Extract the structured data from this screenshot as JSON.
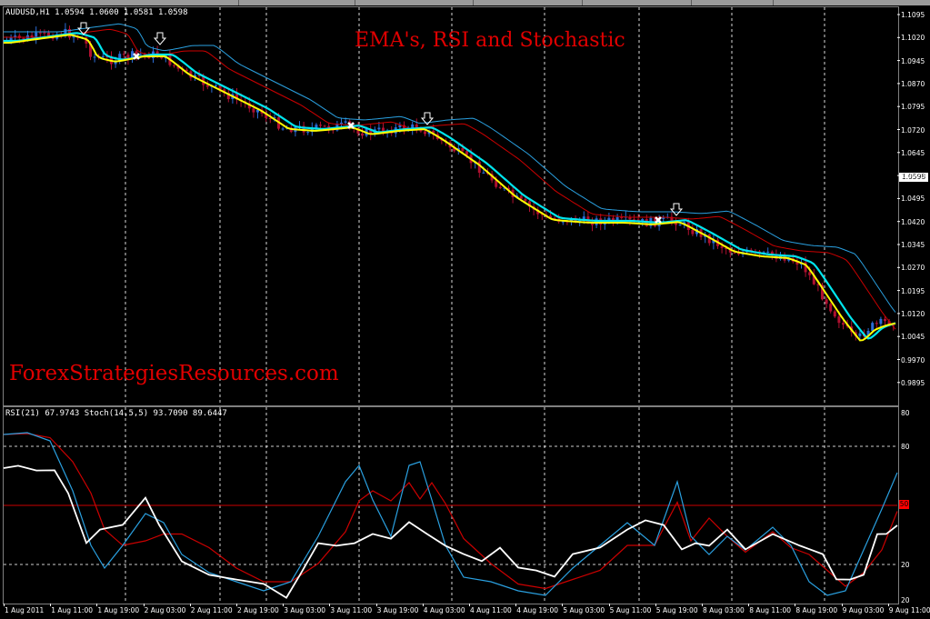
{
  "main_chart": {
    "header": "AUDUSD,H1  1.0594 1.0600 1.0581 1.0598",
    "title": "EMA's, RSI and Stochastic",
    "watermark": "ForexStrategiesResources.com",
    "current_price": "1.0598",
    "price_ticks": [
      "1.1095",
      "1.1020",
      "1.0945",
      "1.0870",
      "1.0795",
      "1.0720",
      "1.0645",
      "1.0570",
      "1.0495",
      "1.0420",
      "1.0345",
      "1.0270",
      "1.0195",
      "1.0120",
      "1.0045",
      "0.9970",
      "0.9895"
    ]
  },
  "indicator_chart": {
    "header": "RSI(21) 67.9743  Stoch(14,5,5) 93.7090 89.6447",
    "level_label": "50",
    "ticks": [
      "80",
      "80",
      "20",
      "20"
    ]
  },
  "time_axis": [
    "1 Aug 2011",
    "1 Aug 11:00",
    "1 Aug 19:00",
    "2 Aug 03:00",
    "2 Aug 11:00",
    "2 Aug 19:00",
    "3 Aug 03:00",
    "3 Aug 11:00",
    "3 Aug 19:00",
    "4 Aug 03:00",
    "4 Aug 11:00",
    "4 Aug 19:00",
    "5 Aug 03:00",
    "5 Aug 11:00",
    "5 Aug 19:00",
    "8 Aug 03:00",
    "8 Aug 11:00",
    "8 Aug 19:00",
    "9 Aug 03:00",
    "9 Aug 11:00"
  ],
  "colors": {
    "ema_fast": "#ffff00",
    "ema_mid": "#00e5ee",
    "ema_slow_red": "#cc0000",
    "ema_slow_blue": "#2aa0e0",
    "rsi": "#ffffff",
    "stoch_main": "#2aa0e0",
    "stoch_signal": "#cc0000",
    "bull_candle": "#2a6cd6",
    "bear_candle": "#b01030",
    "grid": "#ffffff",
    "title_text": "#e00000"
  },
  "markers": {
    "down_arrows": 5,
    "crosses": 4
  }
}
